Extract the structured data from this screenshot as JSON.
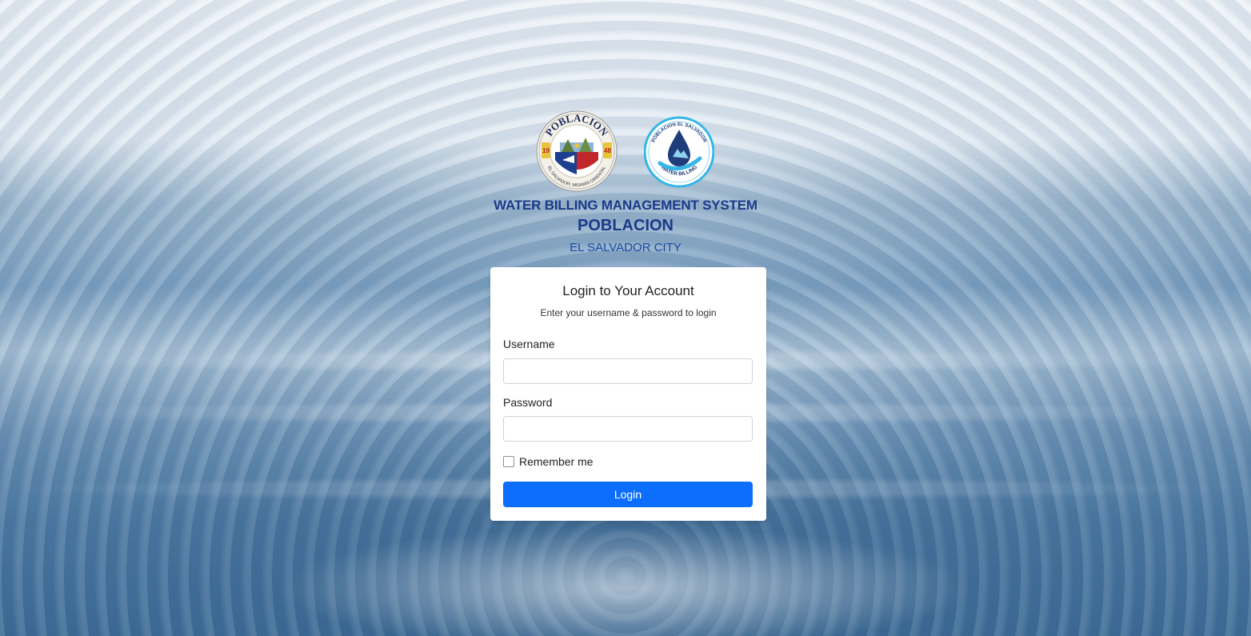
{
  "header": {
    "system_title": "WATER BILLING MANAGEMENT SYSTEM",
    "organization": "POBLACION",
    "city": "EL SALVADOR CITY"
  },
  "logos": {
    "left": {
      "icon": "poblacion-seal-logo",
      "text_top": "POBLACION",
      "year_left": "19",
      "year_right": "48",
      "text_bottom": "EL SALVADOR, MISAMIS ORIENTAL"
    },
    "right": {
      "icon": "water-billing-logo",
      "text_top": "POBLACION EL SALVADOR",
      "text_bottom": "WATER BILLING"
    }
  },
  "login": {
    "title": "Login to Your Account",
    "subtitle": "Enter your username & password to login",
    "username_label": "Username",
    "username_value": "",
    "password_label": "Password",
    "password_value": "",
    "remember_label": "Remember me",
    "remember_checked": false,
    "submit_label": "Login"
  },
  "colors": {
    "title_blue": "#1a3a8a",
    "button_blue": "#0d6efd"
  }
}
